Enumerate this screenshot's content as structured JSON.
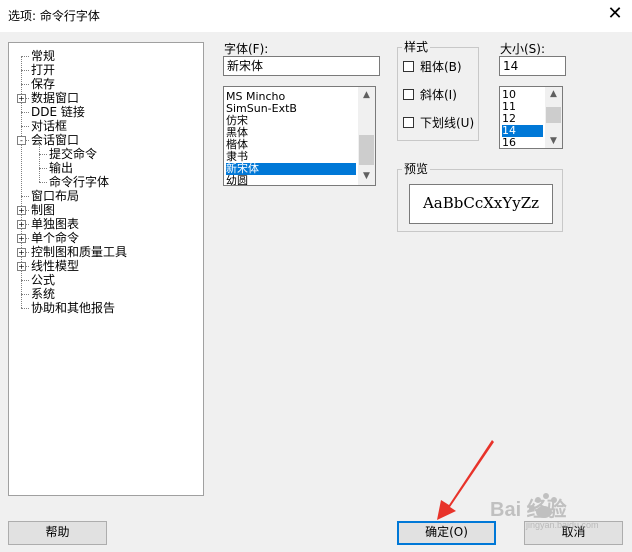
{
  "window": {
    "title": "选项: 命令行字体",
    "close_glyph": "✕"
  },
  "tree": {
    "items": [
      {
        "label": "常规",
        "level": 0,
        "expander": ""
      },
      {
        "label": "打开",
        "level": 0,
        "expander": ""
      },
      {
        "label": "保存",
        "level": 0,
        "expander": ""
      },
      {
        "label": "数据窗口",
        "level": 0,
        "expander": "+"
      },
      {
        "label": "DDE 链接",
        "level": 0,
        "expander": ""
      },
      {
        "label": "对话框",
        "level": 0,
        "expander": ""
      },
      {
        "label": "会话窗口",
        "level": 0,
        "expander": "-"
      },
      {
        "label": "提交命令",
        "level": 1,
        "expander": ""
      },
      {
        "label": "输出",
        "level": 1,
        "expander": ""
      },
      {
        "label": "命令行字体",
        "level": 1,
        "expander": ""
      },
      {
        "label": "窗口布局",
        "level": 0,
        "expander": ""
      },
      {
        "label": "制图",
        "level": 0,
        "expander": "+"
      },
      {
        "label": "单独图表",
        "level": 0,
        "expander": "+"
      },
      {
        "label": "单个命令",
        "level": 0,
        "expander": "+"
      },
      {
        "label": "控制图和质量工具",
        "level": 0,
        "expander": "+"
      },
      {
        "label": "线性模型",
        "level": 0,
        "expander": "+"
      },
      {
        "label": "公式",
        "level": 0,
        "expander": ""
      },
      {
        "label": "系统",
        "level": 0,
        "expander": ""
      },
      {
        "label": "协助和其他报告",
        "level": 0,
        "expander": ""
      }
    ]
  },
  "font": {
    "label": "字体(F):",
    "value": "新宋体",
    "options": [
      "MS Mincho",
      "SimSun-ExtB",
      "仿宋",
      "黑体",
      "楷体",
      "隶书",
      "新宋体",
      "幼圆"
    ],
    "selected_index": 6
  },
  "style": {
    "label": "样式",
    "bold": {
      "label": "粗体(B)",
      "checked": false
    },
    "italic": {
      "label": "斜体(I)",
      "checked": false
    },
    "underline": {
      "label": "下划线(U)",
      "checked": false
    }
  },
  "size": {
    "label": "大小(S):",
    "value": "14",
    "options": [
      "10",
      "11",
      "12",
      "14",
      "16"
    ],
    "selected_index": 3
  },
  "preview": {
    "label": "预览",
    "sample": "AaBbCcXxYyZz"
  },
  "buttons": {
    "help": "帮助",
    "ok": "确定(O)",
    "cancel": "取消"
  },
  "icons": {
    "scroll_up": "▲",
    "scroll_down": "▼",
    "arrow_color": "#e8332a"
  },
  "watermark": {
    "text": "Bai 经验",
    "sub": "jingyan.baidu.com"
  }
}
